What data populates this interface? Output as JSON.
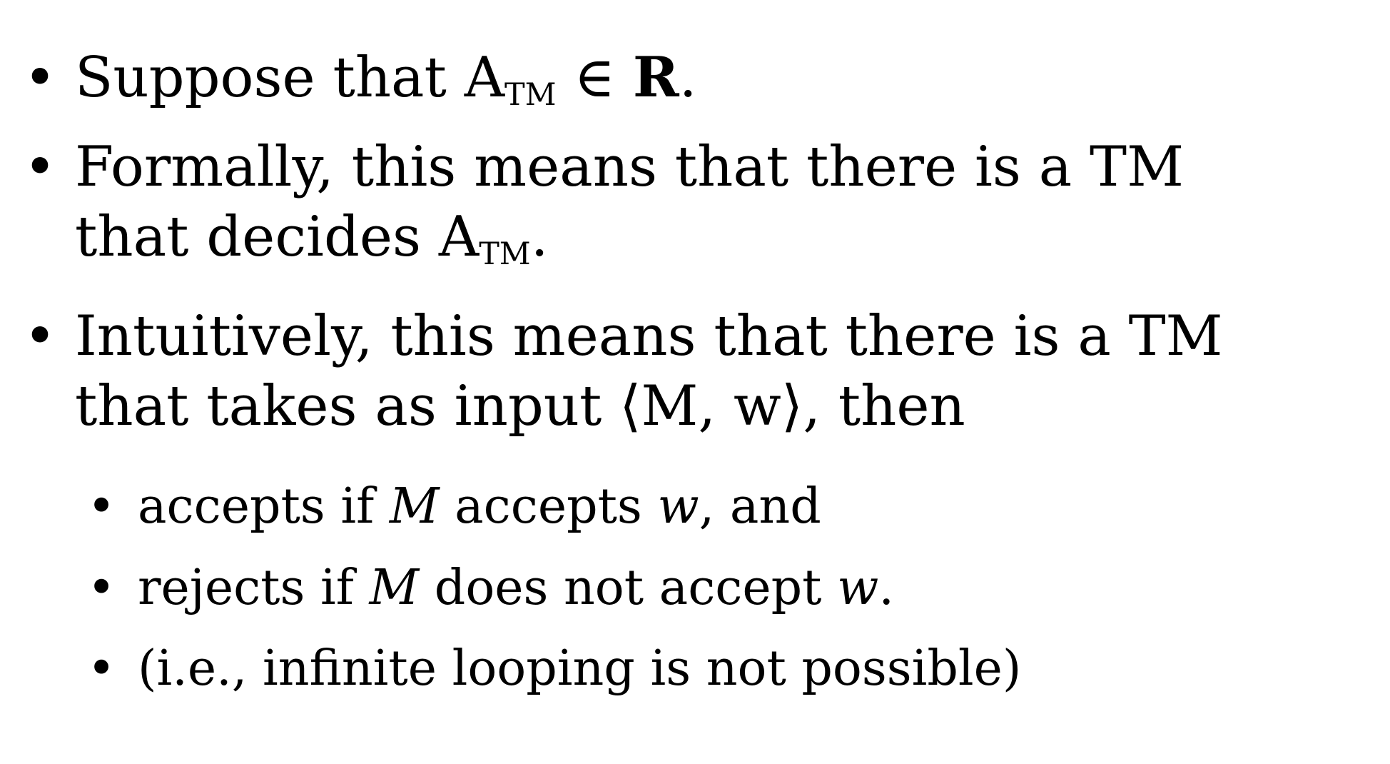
{
  "bullets": [
    {
      "parts": [
        "Suppose that A",
        "TM",
        " ∈ ",
        "R",
        "."
      ]
    },
    {
      "line1": "Formally, this means that there is a TM",
      "line2_parts": [
        "that decides A",
        "TM",
        "."
      ]
    },
    {
      "line1": "Intuitively, this means that there is a TM",
      "line2": "that takes as input ⟨M, w⟩, then"
    }
  ],
  "sub_bullets": [
    {
      "parts": [
        "accepts if ",
        "M",
        " accepts ",
        "w",
        ", and"
      ]
    },
    {
      "parts": [
        "rejects if ",
        "M",
        " does not accept ",
        "w",
        "."
      ]
    },
    {
      "parts": [
        "(i.e., infinite looping is not possible)"
      ]
    }
  ],
  "bullet_glyph": "•"
}
